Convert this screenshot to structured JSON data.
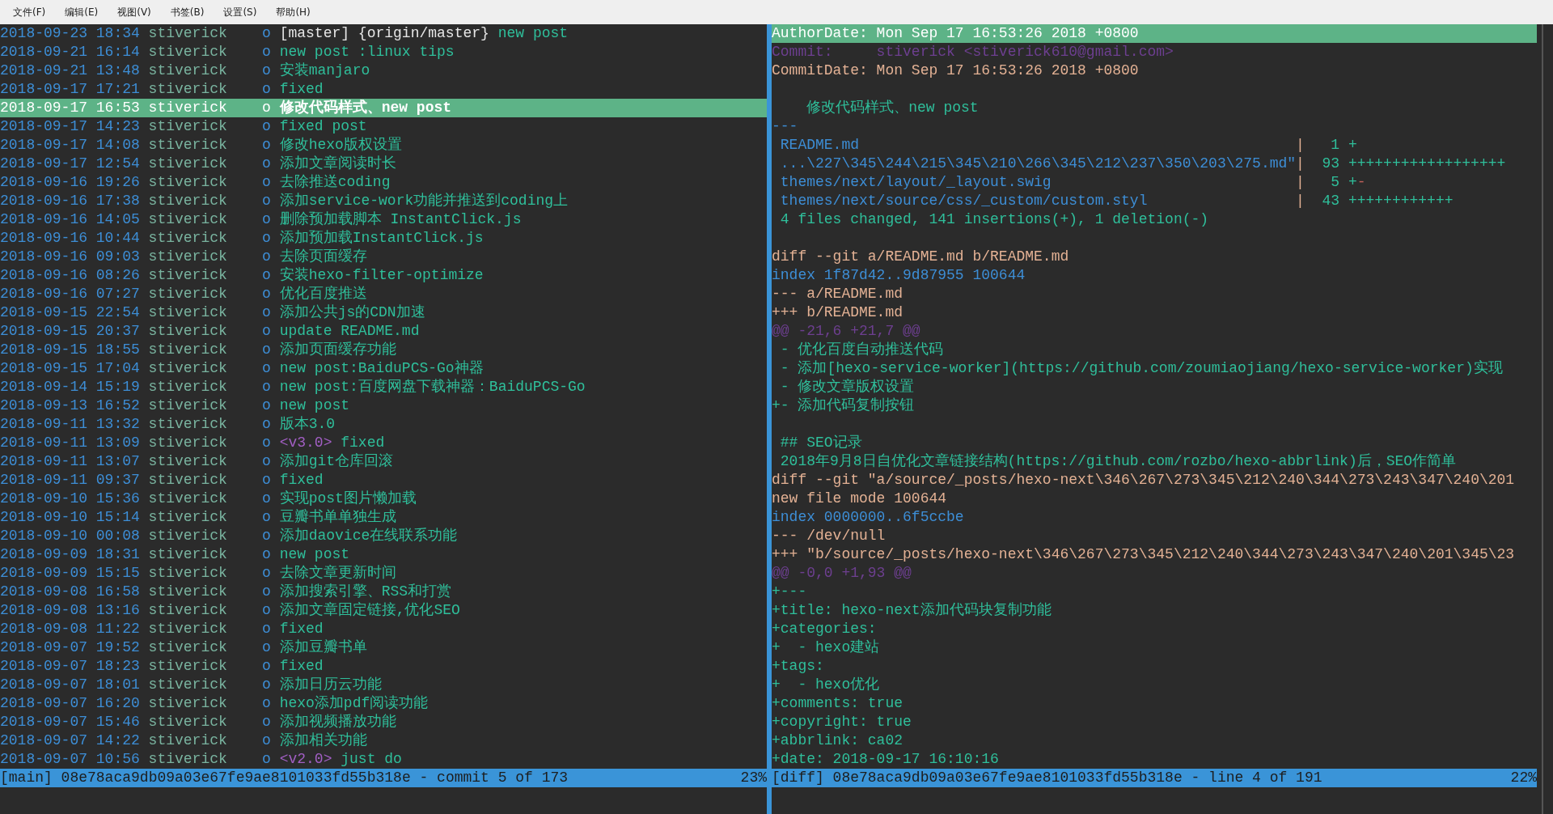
{
  "menu": [
    {
      "label": "文件(F)"
    },
    {
      "label": "编辑(E)"
    },
    {
      "label": "视图(V)"
    },
    {
      "label": "书签(B)"
    },
    {
      "label": "设置(S)"
    },
    {
      "label": "帮助(H)"
    }
  ],
  "log": {
    "commits": [
      {
        "date": "2018-09-23",
        "time": "18:34",
        "author": "stiverick",
        "graph": "o",
        "refs": [
          {
            "kind": "branch",
            "label": "[master]"
          },
          {
            "kind": "remote",
            "label": "{origin/master}"
          }
        ],
        "message": "new post",
        "selected": false
      },
      {
        "date": "2018-09-21",
        "time": "16:14",
        "author": "stiverick",
        "graph": "o",
        "message": "new post :linux tips",
        "selected": false
      },
      {
        "date": "2018-09-21",
        "time": "13:48",
        "author": "stiverick",
        "graph": "o",
        "message": "安装manjaro",
        "selected": false
      },
      {
        "date": "2018-09-17",
        "time": "17:21",
        "author": "stiverick",
        "graph": "o",
        "message": "fixed",
        "selected": false
      },
      {
        "date": "2018-09-17",
        "time": "16:53",
        "author": "stiverick",
        "graph": "o",
        "message": "修改代码样式、new post",
        "selected": true
      },
      {
        "date": "2018-09-17",
        "time": "14:23",
        "author": "stiverick",
        "graph": "o",
        "message": "fixed post",
        "selected": false
      },
      {
        "date": "2018-09-17",
        "time": "14:08",
        "author": "stiverick",
        "graph": "o",
        "message": "修改hexo版权设置",
        "selected": false
      },
      {
        "date": "2018-09-17",
        "time": "12:54",
        "author": "stiverick",
        "graph": "o",
        "message": "添加文章阅读时长",
        "selected": false
      },
      {
        "date": "2018-09-16",
        "time": "19:26",
        "author": "stiverick",
        "graph": "o",
        "message": "去除推送coding",
        "selected": false
      },
      {
        "date": "2018-09-16",
        "time": "17:38",
        "author": "stiverick",
        "graph": "o",
        "message": "添加service-work功能并推送到coding上",
        "selected": false
      },
      {
        "date": "2018-09-16",
        "time": "14:05",
        "author": "stiverick",
        "graph": "o",
        "message": "删除预加载脚本 InstantClick.js",
        "selected": false
      },
      {
        "date": "2018-09-16",
        "time": "10:44",
        "author": "stiverick",
        "graph": "o",
        "message": "添加预加载InstantClick.js",
        "selected": false
      },
      {
        "date": "2018-09-16",
        "time": "09:03",
        "author": "stiverick",
        "graph": "o",
        "message": "去除页面缓存",
        "selected": false
      },
      {
        "date": "2018-09-16",
        "time": "08:26",
        "author": "stiverick",
        "graph": "o",
        "message": "安装hexo-filter-optimize",
        "selected": false
      },
      {
        "date": "2018-09-16",
        "time": "07:27",
        "author": "stiverick",
        "graph": "o",
        "message": "优化百度推送",
        "selected": false
      },
      {
        "date": "2018-09-15",
        "time": "22:54",
        "author": "stiverick",
        "graph": "o",
        "message": "添加公共js的CDN加速",
        "selected": false
      },
      {
        "date": "2018-09-15",
        "time": "20:37",
        "author": "stiverick",
        "graph": "o",
        "message": "update README.md",
        "selected": false
      },
      {
        "date": "2018-09-15",
        "time": "18:55",
        "author": "stiverick",
        "graph": "o",
        "message": "添加页面缓存功能",
        "selected": false
      },
      {
        "date": "2018-09-15",
        "time": "17:04",
        "author": "stiverick",
        "graph": "o",
        "message": "new post:BaiduPCS-Go神器",
        "selected": false
      },
      {
        "date": "2018-09-14",
        "time": "15:19",
        "author": "stiverick",
        "graph": "o",
        "message": "new post:百度网盘下载神器：BaiduPCS-Go",
        "selected": false
      },
      {
        "date": "2018-09-13",
        "time": "16:52",
        "author": "stiverick",
        "graph": "o",
        "message": "new post",
        "selected": false
      },
      {
        "date": "2018-09-11",
        "time": "13:32",
        "author": "stiverick",
        "graph": "o",
        "message": "版本3.0",
        "selected": false
      },
      {
        "date": "2018-09-11",
        "time": "13:09",
        "author": "stiverick",
        "graph": "o",
        "refs": [
          {
            "kind": "tag",
            "label": "<v3.0>"
          }
        ],
        "message": "fixed",
        "selected": false
      },
      {
        "date": "2018-09-11",
        "time": "13:07",
        "author": "stiverick",
        "graph": "o",
        "message": "添加git仓库回滚",
        "selected": false
      },
      {
        "date": "2018-09-11",
        "time": "09:37",
        "author": "stiverick",
        "graph": "o",
        "message": "fixed",
        "selected": false
      },
      {
        "date": "2018-09-10",
        "time": "15:36",
        "author": "stiverick",
        "graph": "o",
        "message": "实现post图片懒加载",
        "selected": false
      },
      {
        "date": "2018-09-10",
        "time": "15:14",
        "author": "stiverick",
        "graph": "o",
        "message": "豆瓣书单单独生成",
        "selected": false
      },
      {
        "date": "2018-09-10",
        "time": "00:08",
        "author": "stiverick",
        "graph": "o",
        "message": "添加daovice在线联系功能",
        "selected": false
      },
      {
        "date": "2018-09-09",
        "time": "18:31",
        "author": "stiverick",
        "graph": "o",
        "message": "new post",
        "selected": false
      },
      {
        "date": "2018-09-09",
        "time": "15:15",
        "author": "stiverick",
        "graph": "o",
        "message": "去除文章更新时间",
        "selected": false
      },
      {
        "date": "2018-09-08",
        "time": "16:58",
        "author": "stiverick",
        "graph": "o",
        "message": "添加搜索引擎、RSS和打赏",
        "selected": false
      },
      {
        "date": "2018-09-08",
        "time": "13:16",
        "author": "stiverick",
        "graph": "o",
        "message": "添加文章固定链接,优化SEO",
        "selected": false
      },
      {
        "date": "2018-09-08",
        "time": "11:22",
        "author": "stiverick",
        "graph": "o",
        "message": "fixed",
        "selected": false
      },
      {
        "date": "2018-09-07",
        "time": "19:52",
        "author": "stiverick",
        "graph": "o",
        "message": "添加豆瓣书单",
        "selected": false
      },
      {
        "date": "2018-09-07",
        "time": "18:23",
        "author": "stiverick",
        "graph": "o",
        "message": "fixed",
        "selected": false
      },
      {
        "date": "2018-09-07",
        "time": "18:01",
        "author": "stiverick",
        "graph": "o",
        "message": "添加日历云功能",
        "selected": false
      },
      {
        "date": "2018-09-07",
        "time": "16:20",
        "author": "stiverick",
        "graph": "o",
        "message": "hexo添加pdf阅读功能",
        "selected": false
      },
      {
        "date": "2018-09-07",
        "time": "15:46",
        "author": "stiverick",
        "graph": "o",
        "message": "添加视频播放功能",
        "selected": false
      },
      {
        "date": "2018-09-07",
        "time": "14:22",
        "author": "stiverick",
        "graph": "o",
        "message": "添加相关功能",
        "selected": false
      },
      {
        "date": "2018-09-07",
        "time": "10:56",
        "author": "stiverick",
        "graph": "o",
        "refs": [
          {
            "kind": "tag",
            "label": "<v2.0>"
          }
        ],
        "message": "just do",
        "selected": false
      }
    ],
    "status": {
      "text": "[main] 08e78aca9db09a03e67fe9ae8101033fd55b318e - commit 5 of 173",
      "percent": "23%"
    }
  },
  "diff": {
    "lines": [
      {
        "kind": "author_date",
        "text": "AuthorDate: Mon Sep 17 16:53:26 2018 +0800",
        "selected": true
      },
      {
        "kind": "committer",
        "text": "Commit:     stiverick <stiverick610@gmail.com>",
        "selected": false
      },
      {
        "kind": "commit_date",
        "text": "CommitDate: Mon Sep 17 16:53:26 2018 +0800",
        "selected": false
      },
      {
        "kind": "blank"
      },
      {
        "kind": "message",
        "text": "修改代码样式、new post",
        "selected": false
      },
      {
        "kind": "separator",
        "text": "---",
        "selected": false
      },
      {
        "kind": "stat",
        "file": "README.md",
        "pipe": "|",
        "count": "1",
        "plus": "+",
        "selected": false
      },
      {
        "kind": "stat",
        "file": "...\\227\\345\\244\\215\\345\\210\\266\\345\\212\\237\\350\\203\\275.md\"",
        "pipe": "|",
        "count": "93",
        "plus": "++++++++++++++++++",
        "selected": false
      },
      {
        "kind": "stat",
        "file": "themes/next/layout/_layout.swig",
        "pipe": "|",
        "count": "5",
        "plus": "+",
        "minus": "-",
        "selected": false
      },
      {
        "kind": "stat",
        "file": "themes/next/source/css/_custom/custom.styl",
        "pipe": "|",
        "count": "43",
        "plus": "++++++++++++",
        "selected": false
      },
      {
        "kind": "summary",
        "text": "4 files changed, 141 insertions(+), 1 deletion(-)",
        "selected": false
      },
      {
        "kind": "blank"
      },
      {
        "kind": "diff_header",
        "text": "diff --git a/README.md b/README.md",
        "selected": false
      },
      {
        "kind": "index",
        "text": "index 1f87d42..9d87955 100644",
        "selected": false
      },
      {
        "kind": "file_header",
        "text": "--- a/README.md",
        "selected": false
      },
      {
        "kind": "file_header",
        "text": "+++ b/README.md",
        "selected": false
      },
      {
        "kind": "hunk",
        "text": "@@ -21,6 +21,7 @@",
        "selected": false
      },
      {
        "kind": "context",
        "text": " - 优化百度自动推送代码",
        "selected": false
      },
      {
        "kind": "context",
        "text": " - 添加[hexo-service-worker](https://github.com/zoumiaojiang/hexo-service-worker)实现",
        "selected": false
      },
      {
        "kind": "context",
        "text": " - 修改文章版权设置",
        "selected": false
      },
      {
        "kind": "added",
        "text": "+- 添加代码复制按钮",
        "selected": false
      },
      {
        "kind": "blank"
      },
      {
        "kind": "context",
        "text": " ## SEO记录",
        "selected": false
      },
      {
        "kind": "context",
        "text": " 2018年9月8日自优化文章链接结构(https://github.com/rozbo/hexo-abbrlink)后，SEO作简单",
        "selected": false
      },
      {
        "kind": "diff_header",
        "text": "diff --git \"a/source/_posts/hexo-next\\346\\267\\273\\345\\212\\240\\344\\273\\243\\347\\240\\201",
        "selected": false
      },
      {
        "kind": "diff_header",
        "text": "new file mode 100644",
        "selected": false
      },
      {
        "kind": "index",
        "text": "index 0000000..6f5ccbe",
        "selected": false
      },
      {
        "kind": "file_header",
        "text": "--- /dev/null",
        "selected": false
      },
      {
        "kind": "file_header",
        "text": "+++ \"b/source/_posts/hexo-next\\346\\267\\273\\345\\212\\240\\344\\273\\243\\347\\240\\201\\345\\23",
        "selected": false
      },
      {
        "kind": "hunk",
        "text": "@@ -0,0 +1,93 @@",
        "selected": false
      },
      {
        "kind": "added",
        "text": "+---",
        "selected": false
      },
      {
        "kind": "added",
        "text": "+title: hexo-next添加代码块复制功能",
        "selected": false
      },
      {
        "kind": "added",
        "text": "+categories:",
        "selected": false
      },
      {
        "kind": "added",
        "text": "+  - hexo建站",
        "selected": false
      },
      {
        "kind": "added",
        "text": "+tags:",
        "selected": false
      },
      {
        "kind": "added",
        "text": "+  - hexo优化",
        "selected": false
      },
      {
        "kind": "added",
        "text": "+comments: true",
        "selected": false
      },
      {
        "kind": "added",
        "text": "+copyright: true",
        "selected": false
      },
      {
        "kind": "added",
        "text": "+abbrlink: ca02",
        "selected": false
      },
      {
        "kind": "added",
        "text": "+date: 2018-09-17 16:10:16",
        "selected": false
      }
    ],
    "status": {
      "text": "[diff] 08e78aca9db09a03e67fe9ae8101033fd55b318e - line 4 of 191",
      "percent": "22%"
    }
  }
}
